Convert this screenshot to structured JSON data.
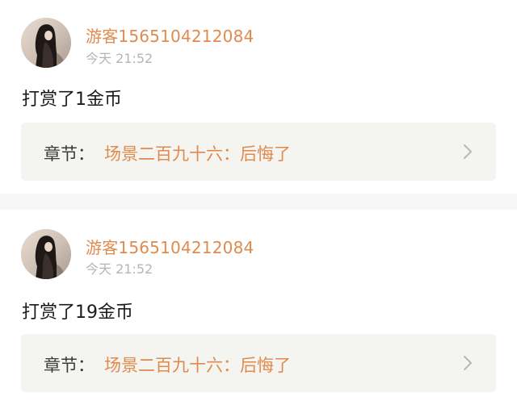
{
  "rewards": [
    {
      "username": "游客1565104212084",
      "time": "今天 21:52",
      "action": "打赏了1金币",
      "chapter_prefix": "章节：",
      "chapter_title": "场景二百九十六：后悔了",
      "chevron_icon": "chevron-right-icon"
    },
    {
      "username": "游客1565104212084",
      "time": "今天 21:52",
      "action": "打赏了19金币",
      "chapter_prefix": "章节：",
      "chapter_title": "场景二百九十六：后悔了",
      "chevron_icon": "chevron-right-icon"
    }
  ],
  "colors": {
    "accent": "#e08a4e",
    "timestamp": "#b5b5b5",
    "chapter_bg": "#f4f4f0",
    "divider": "#f6f6f6"
  }
}
